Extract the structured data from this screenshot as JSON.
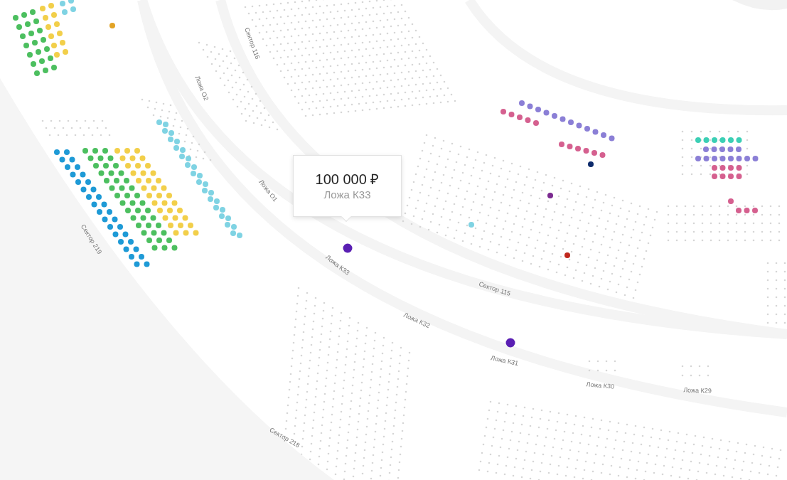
{
  "map": {
    "labels": [
      {
        "text": "Сектор 116"
      },
      {
        "text": "Ложа О2"
      },
      {
        "text": "Ложа О1"
      },
      {
        "text": "Сектор 219"
      },
      {
        "text": "Ложа К33"
      },
      {
        "text": "Сектор 115"
      },
      {
        "text": "Ложа К32"
      },
      {
        "text": "Ложа К31"
      },
      {
        "text": "Ложа К30"
      },
      {
        "text": "Ложа К29"
      },
      {
        "text": "Сектор 218"
      }
    ]
  },
  "tooltip": {
    "price": "100 000 ₽",
    "box": "Ложа К33"
  }
}
